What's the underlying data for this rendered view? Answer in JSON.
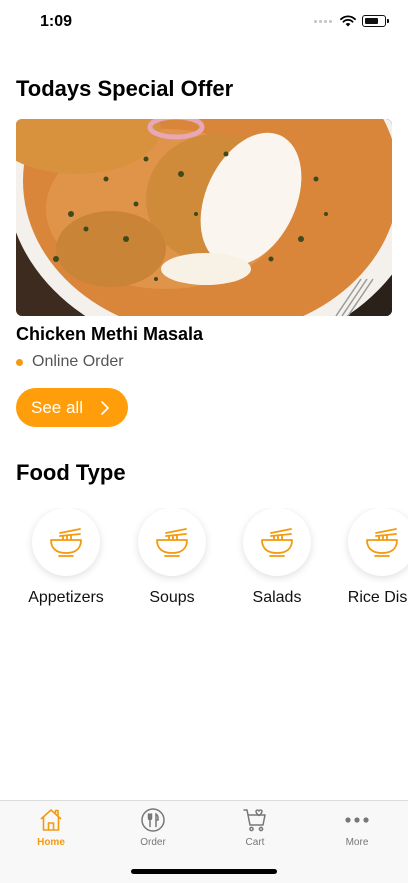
{
  "status_bar": {
    "time": "1:09",
    "icons": [
      "signal-icon",
      "wifi-icon",
      "battery-icon"
    ]
  },
  "offer": {
    "title": "Todays Special Offer",
    "image": "chicken-curry-dish-photo",
    "dish_name": "Chicken Methi Masala",
    "order_type": "Online Order",
    "see_all_label": "See all"
  },
  "food_type": {
    "title": "Food Type",
    "items": [
      {
        "label": "Appetizers",
        "icon": "noodle-bowl-icon"
      },
      {
        "label": "Soups",
        "icon": "noodle-bowl-icon"
      },
      {
        "label": "Salads",
        "icon": "noodle-bowl-icon"
      },
      {
        "label": "Rice Dish",
        "icon": "noodle-bowl-icon"
      }
    ]
  },
  "tab_bar": {
    "tabs": [
      {
        "label": "Home",
        "icon": "home-icon",
        "active": true
      },
      {
        "label": "Order",
        "icon": "plate-cutlery-icon",
        "active": false
      },
      {
        "label": "Cart",
        "icon": "cart-icon",
        "active": false
      },
      {
        "label": "More",
        "icon": "more-dots-icon",
        "active": false
      }
    ]
  },
  "colors": {
    "accent": "#ff9d0a",
    "icon_orange": "#f39a0f",
    "text_primary": "#000000",
    "text_secondary": "#555555",
    "tab_inactive": "#777777"
  }
}
